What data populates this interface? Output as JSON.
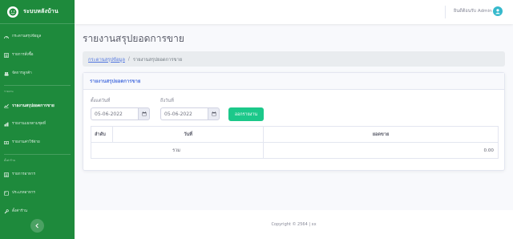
{
  "brand": {
    "name": "ระบบหลังบ้าน",
    "icon": "smile-icon"
  },
  "sidebar": {
    "items": [
      {
        "label": "กระดานสรุปข้อมูล",
        "icon": "dashboard-icon"
      },
      {
        "label": "รายการสั่งซื้อ",
        "icon": "list-icon"
      },
      {
        "label": "จัดการลูกค้า",
        "icon": "users-icon"
      }
    ],
    "section_report": "รายงาน",
    "reports": [
      {
        "label": "รายงานสรุปยอดการขาย",
        "icon": "chart-icon",
        "active": true
      },
      {
        "label": "รายงานแยกตามชุดที่",
        "icon": "chart-bar-icon"
      },
      {
        "label": "รายงานค่าใช้จ่าย",
        "icon": "money-icon"
      }
    ],
    "section_settings": "ตั้งค่าร้าน",
    "settings": [
      {
        "label": "รายการอาหาร",
        "icon": "list-icon"
      },
      {
        "label": "ประเภทอาหาร",
        "icon": "tags-icon"
      },
      {
        "label": "ตั้งค่าร้าน",
        "icon": "wrench-icon"
      }
    ]
  },
  "topbar": {
    "user_label": "ยินดีต้อนรับ Admin",
    "avatar_icon": "user-icon"
  },
  "page": {
    "title": "รายงานสรุปยอดการขาย"
  },
  "breadcrumb": {
    "home": "กระดานสรุปข้อมูล",
    "separator": "/",
    "current": "รายงานสรุปยอดการขาย"
  },
  "card": {
    "title": "รายงานสรุปยอดการขาย",
    "start_label": "ตั้งแต่วันที่",
    "start_value": "05-06-2022",
    "end_label": "ถึงวันที่",
    "end_value": "05-06-2022",
    "button_label": "ออกรายงาน"
  },
  "table": {
    "headers": [
      "ลำดับ",
      "วันที่",
      "ยอดขาย"
    ],
    "total_label": "รวม",
    "total_value": "0.00"
  },
  "footer": {
    "text": "Copyright © 2564 | xx"
  },
  "colors": {
    "sidebar": "#1e8a3c",
    "primary": "#4e73df",
    "success": "#1cc88a",
    "info": "#36b9cc"
  }
}
